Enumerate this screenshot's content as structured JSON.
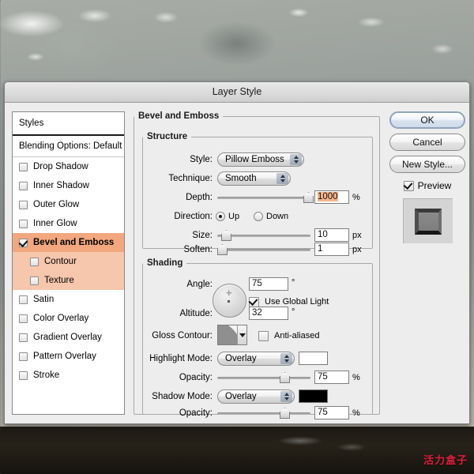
{
  "background": {
    "watermark": "活力盒子"
  },
  "dialog": {
    "title": "Layer Style"
  },
  "styles_panel": {
    "header": "Styles",
    "blending_options": "Blending Options: Default",
    "items": [
      {
        "label": "Drop Shadow",
        "checked": false,
        "sub": false,
        "selected": false
      },
      {
        "label": "Inner Shadow",
        "checked": false,
        "sub": false,
        "selected": false
      },
      {
        "label": "Outer Glow",
        "checked": false,
        "sub": false,
        "selected": false
      },
      {
        "label": "Inner Glow",
        "checked": false,
        "sub": false,
        "selected": false
      },
      {
        "label": "Bevel and Emboss",
        "checked": true,
        "sub": false,
        "selected": true
      },
      {
        "label": "Contour",
        "checked": false,
        "sub": true,
        "selected": false
      },
      {
        "label": "Texture",
        "checked": false,
        "sub": true,
        "selected": false
      },
      {
        "label": "Satin",
        "checked": false,
        "sub": false,
        "selected": false
      },
      {
        "label": "Color Overlay",
        "checked": false,
        "sub": false,
        "selected": false
      },
      {
        "label": "Gradient Overlay",
        "checked": false,
        "sub": false,
        "selected": false
      },
      {
        "label": "Pattern Overlay",
        "checked": false,
        "sub": false,
        "selected": false
      },
      {
        "label": "Stroke",
        "checked": false,
        "sub": false,
        "selected": false
      }
    ],
    "highlight_color": "#f2a77e",
    "sub_highlight_color": "#f6c6ad"
  },
  "bevel": {
    "group_label": "Bevel and Emboss",
    "structure": {
      "group_label": "Structure",
      "style_label": "Style:",
      "style_value": "Pillow Emboss",
      "technique_label": "Technique:",
      "technique_value": "Smooth",
      "depth_label": "Depth:",
      "depth_value": "1000",
      "depth_unit": "%",
      "direction_label": "Direction:",
      "direction_up": "Up",
      "direction_down": "Down",
      "direction_selected": "Up",
      "size_label": "Size:",
      "size_value": "10",
      "size_unit": "px",
      "soften_label": "Soften:",
      "soften_value": "1",
      "soften_unit": "px"
    },
    "shading": {
      "group_label": "Shading",
      "angle_label": "Angle:",
      "angle_value": "75",
      "angle_unit": "°",
      "global_light_label": "Use Global Light",
      "global_light_checked": true,
      "altitude_label": "Altitude:",
      "altitude_value": "32",
      "altitude_unit": "°",
      "gloss_contour_label": "Gloss Contour:",
      "anti_aliased_label": "Anti-aliased",
      "anti_aliased_checked": false,
      "highlight_mode_label": "Highlight Mode:",
      "highlight_mode_value": "Overlay",
      "highlight_color": "#ffffff",
      "highlight_opacity_label": "Opacity:",
      "highlight_opacity_value": "75",
      "highlight_opacity_unit": "%",
      "shadow_mode_label": "Shadow Mode:",
      "shadow_mode_value": "Overlay",
      "shadow_color": "#000000",
      "shadow_opacity_label": "Opacity:",
      "shadow_opacity_value": "75",
      "shadow_opacity_unit": "%"
    }
  },
  "actions": {
    "ok": "OK",
    "cancel": "Cancel",
    "new_style": "New Style...",
    "preview_label": "Preview",
    "preview_checked": true
  }
}
